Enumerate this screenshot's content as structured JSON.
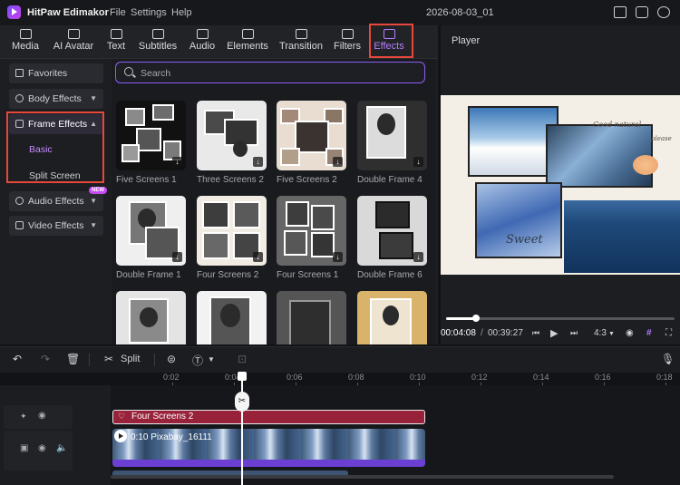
{
  "app": {
    "name": "HitPaw Edimakor",
    "menu": [
      "File",
      "Settings",
      "Help"
    ],
    "project_title": "2026-08-03_01"
  },
  "tabs": [
    {
      "label": "Media",
      "icon": "media-icon"
    },
    {
      "label": "AI Avatar",
      "icon": "ai-avatar-icon"
    },
    {
      "label": "Text",
      "icon": "text-icon"
    },
    {
      "label": "Subtitles",
      "icon": "subtitles-icon"
    },
    {
      "label": "Audio",
      "icon": "audio-icon"
    },
    {
      "label": "Elements",
      "icon": "elements-icon"
    },
    {
      "label": "Transition",
      "icon": "transition-icon"
    },
    {
      "label": "Filters",
      "icon": "filters-icon"
    },
    {
      "label": "Effects",
      "icon": "effects-icon",
      "active": true
    }
  ],
  "sidebar": {
    "favorites": "Favorites",
    "body_effects": "Body Effects",
    "frame_effects": "Frame Effects",
    "frame_sub": [
      "Basic",
      "Split Screen"
    ],
    "audio_effects": "Audio Effects",
    "audio_badge": "NEW",
    "video_effects": "Video Effects"
  },
  "search": {
    "placeholder": "Search"
  },
  "effects_grid": [
    "Five Screens 1",
    "Three Screens 2",
    "Five Screens 2",
    "Double Frame 4",
    "Double Frame 1",
    "Four Screens 2",
    "Four Screens 1",
    "Double Frame 6"
  ],
  "player": {
    "title": "Player",
    "current_time": "00:04:08",
    "total_time": "00:39:27",
    "progress": 0.13,
    "aspect": "4:3",
    "preview_text": [
      "Sweet",
      "Good natural",
      "please"
    ]
  },
  "timeline": {
    "split_label": "Split",
    "ticks": [
      "0:02",
      "0:04",
      "0:06",
      "0:08",
      "0:10",
      "0:12",
      "0:14",
      "0:16",
      "0:18"
    ],
    "effect_clip": "Four Screens 2",
    "video_clip": "0:10 Pixabay_16111"
  },
  "colors": {
    "accent": "#b57cff",
    "highlight": "#e8483a",
    "effect_clip": "#98223a",
    "video_bar": "#6a3fd1"
  }
}
